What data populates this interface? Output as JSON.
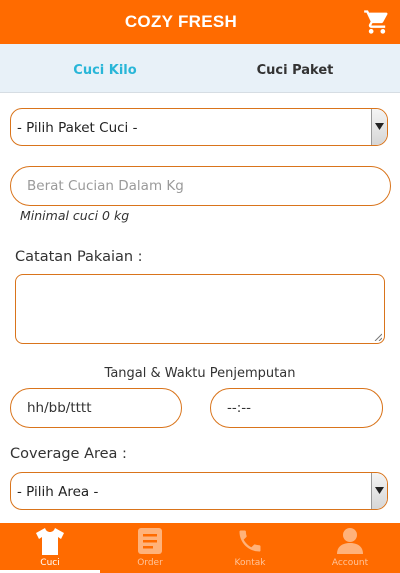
{
  "header": {
    "title": "COZY FRESH"
  },
  "tabs": [
    {
      "label": "Cuci Kilo",
      "active": true
    },
    {
      "label": "Cuci Paket",
      "active": false
    }
  ],
  "form": {
    "paket_select": {
      "selected": "- Pilih Paket Cuci -"
    },
    "berat_input": {
      "placeholder": "Berat Cucian Dalam Kg",
      "value": ""
    },
    "berat_hint": "Minimal cuci 0 kg",
    "catatan_label": "Catatan Pakaian :",
    "catatan_value": "",
    "jadwal_label": "Tangal & Waktu Penjemputan",
    "date_input": {
      "value": "hh/bb/tttt"
    },
    "time_input": {
      "value": "--:--"
    },
    "coverage_label": "Coverage Area :",
    "area_select": {
      "selected": "- Pilih Area -"
    }
  },
  "bottom_nav": [
    {
      "label": "Cuci",
      "icon": "shirt-icon",
      "active": true
    },
    {
      "label": "Order",
      "icon": "document-icon",
      "active": false
    },
    {
      "label": "Kontak",
      "icon": "phone-icon",
      "active": false
    },
    {
      "label": "Account",
      "icon": "person-icon",
      "active": false
    }
  ],
  "colors": {
    "primary": "#ff6b00",
    "accent": "#29b6d8",
    "tab_bar": "#e8f1f8",
    "border": "#d9741b"
  }
}
